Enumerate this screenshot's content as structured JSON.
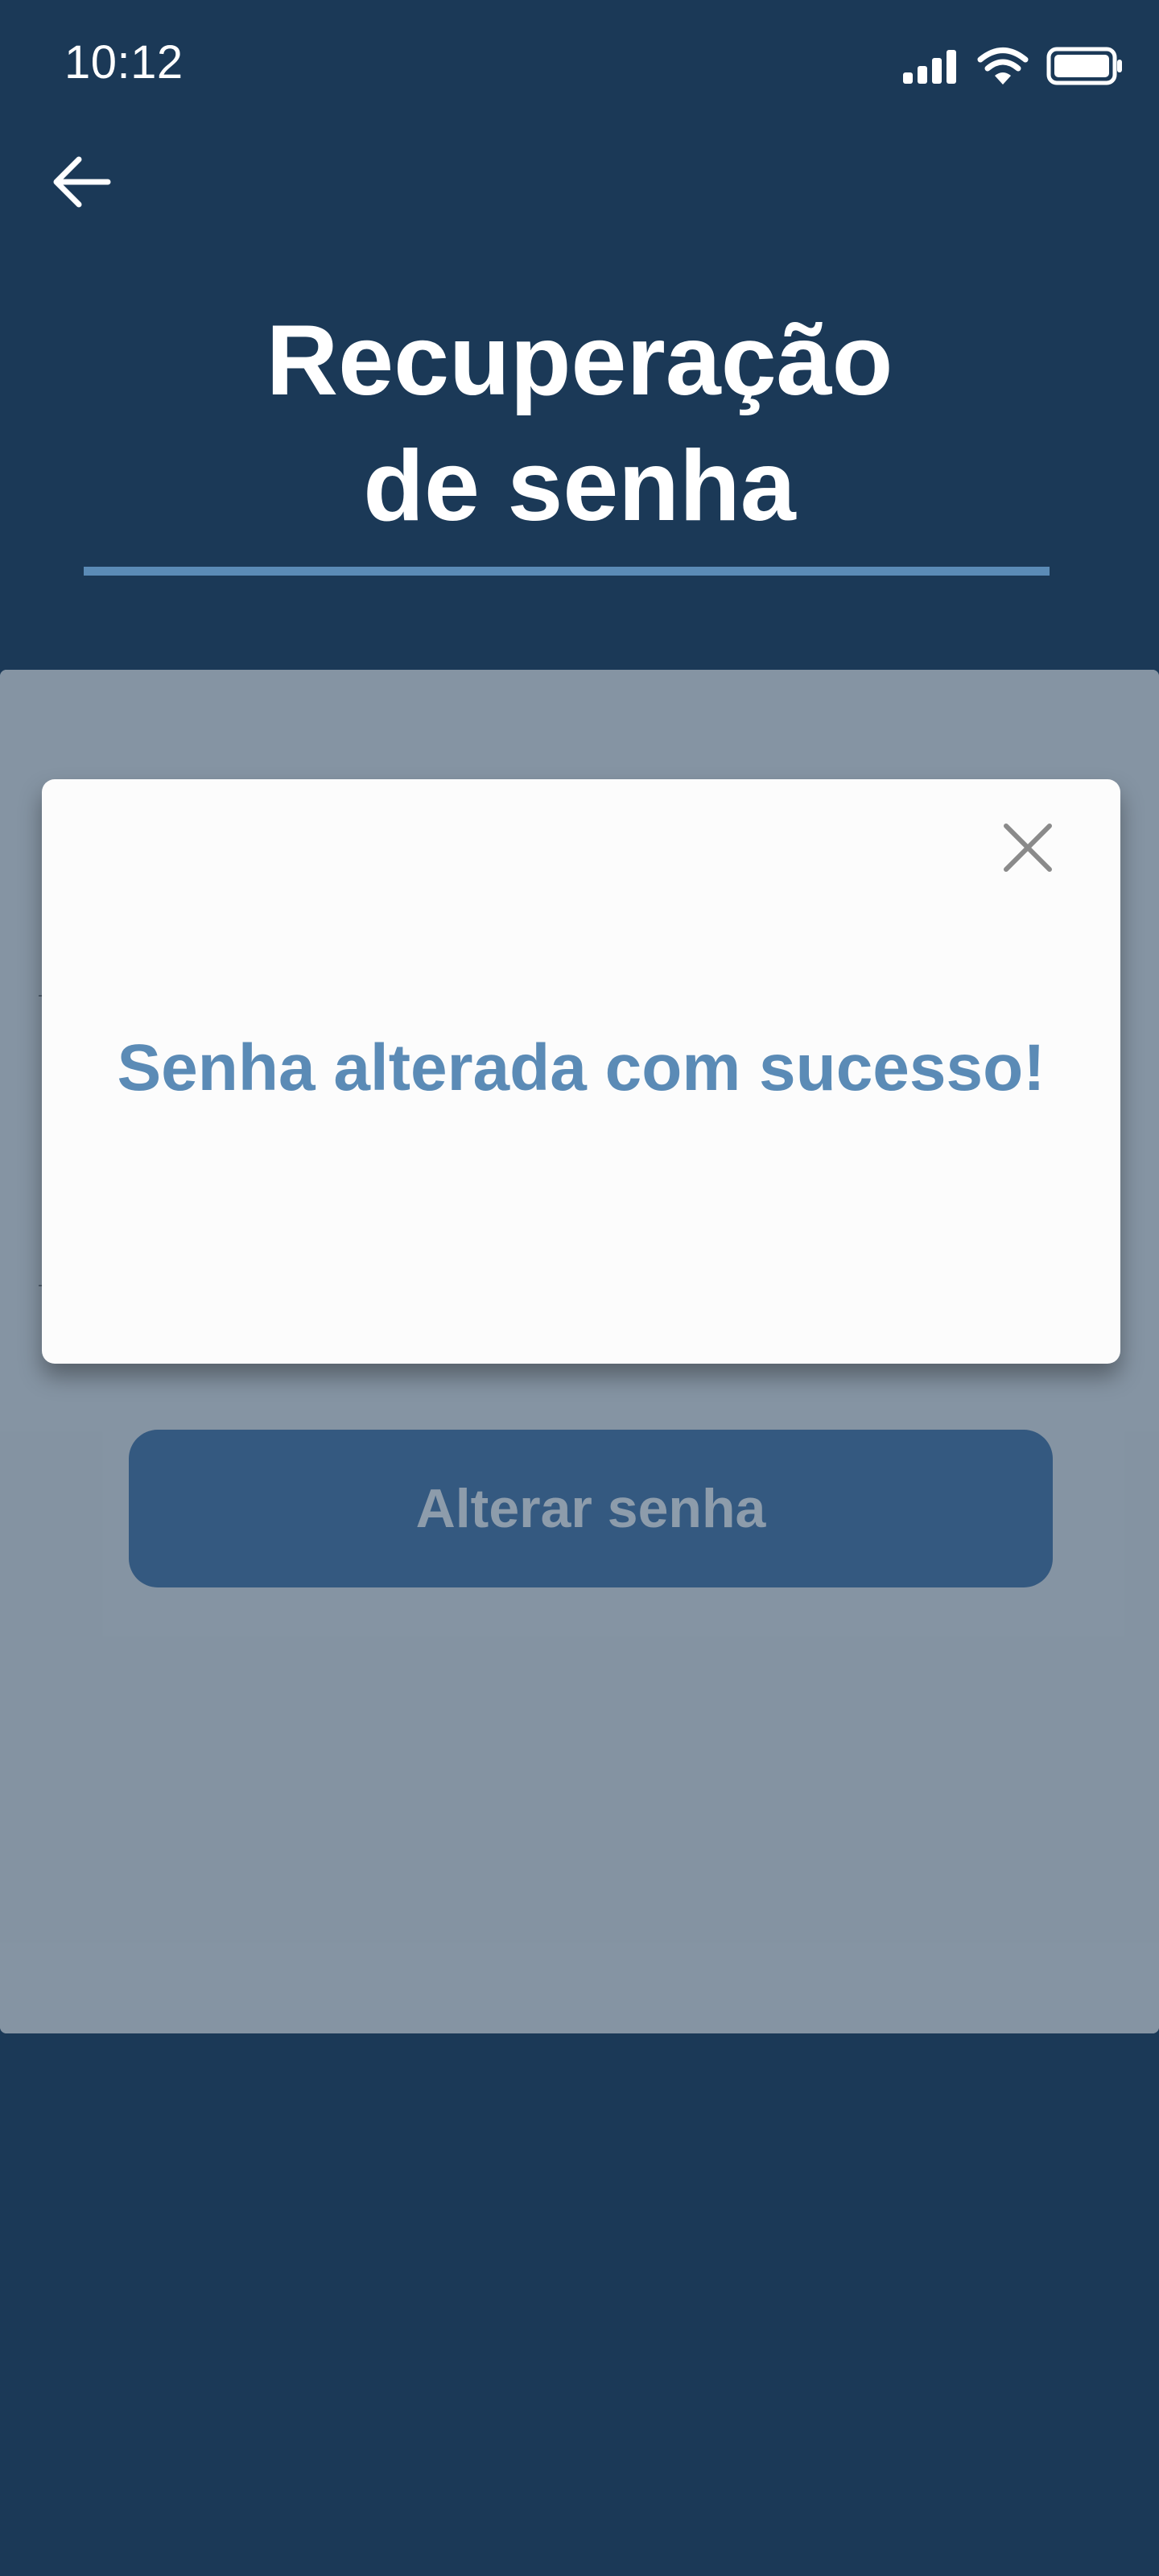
{
  "status_bar": {
    "time": "10:12",
    "icons": [
      "signal-icon",
      "wifi-icon",
      "battery-icon"
    ]
  },
  "header": {
    "back_icon": "arrow-left-icon",
    "title_line1": "Recuperação",
    "title_line2": "de senha"
  },
  "form": {
    "submit_label": "Alterar senha"
  },
  "modal": {
    "close_icon": "close-icon",
    "message": "Senha alterada com sucesso!"
  },
  "colors": {
    "background": "#1b3957",
    "accent": "#5b8bb6",
    "button": "#4c78a8",
    "modal_bg": "#fcfcfc",
    "overlay": "rgba(27, 57, 87, 0.5)"
  }
}
